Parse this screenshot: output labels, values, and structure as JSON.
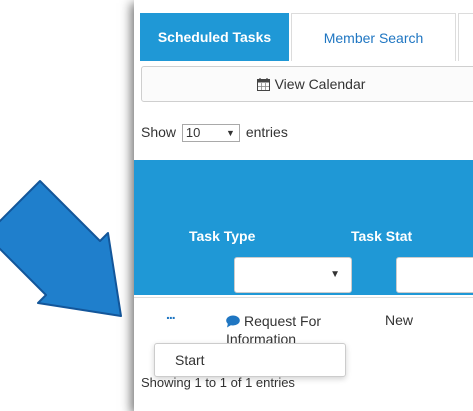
{
  "tabs": {
    "scheduled_tasks": "Scheduled Tasks",
    "member_search": "Member Search"
  },
  "calendar": {
    "label": "View Calendar",
    "icon": "calendar-icon"
  },
  "length": {
    "prefix": "Show",
    "value": "10",
    "suffix": "entries"
  },
  "table": {
    "headers": {
      "task_type": "Task Type",
      "task_status": "Task Stat"
    },
    "row": {
      "actions": "...",
      "task_type": "Request For Information",
      "task_status": "New"
    }
  },
  "context_menu": {
    "start": "Start"
  },
  "info": "Showing 1 to 1 of 1 entries",
  "colors": {
    "accent": "#1f98d6",
    "arrow": "#1f6fc0"
  }
}
